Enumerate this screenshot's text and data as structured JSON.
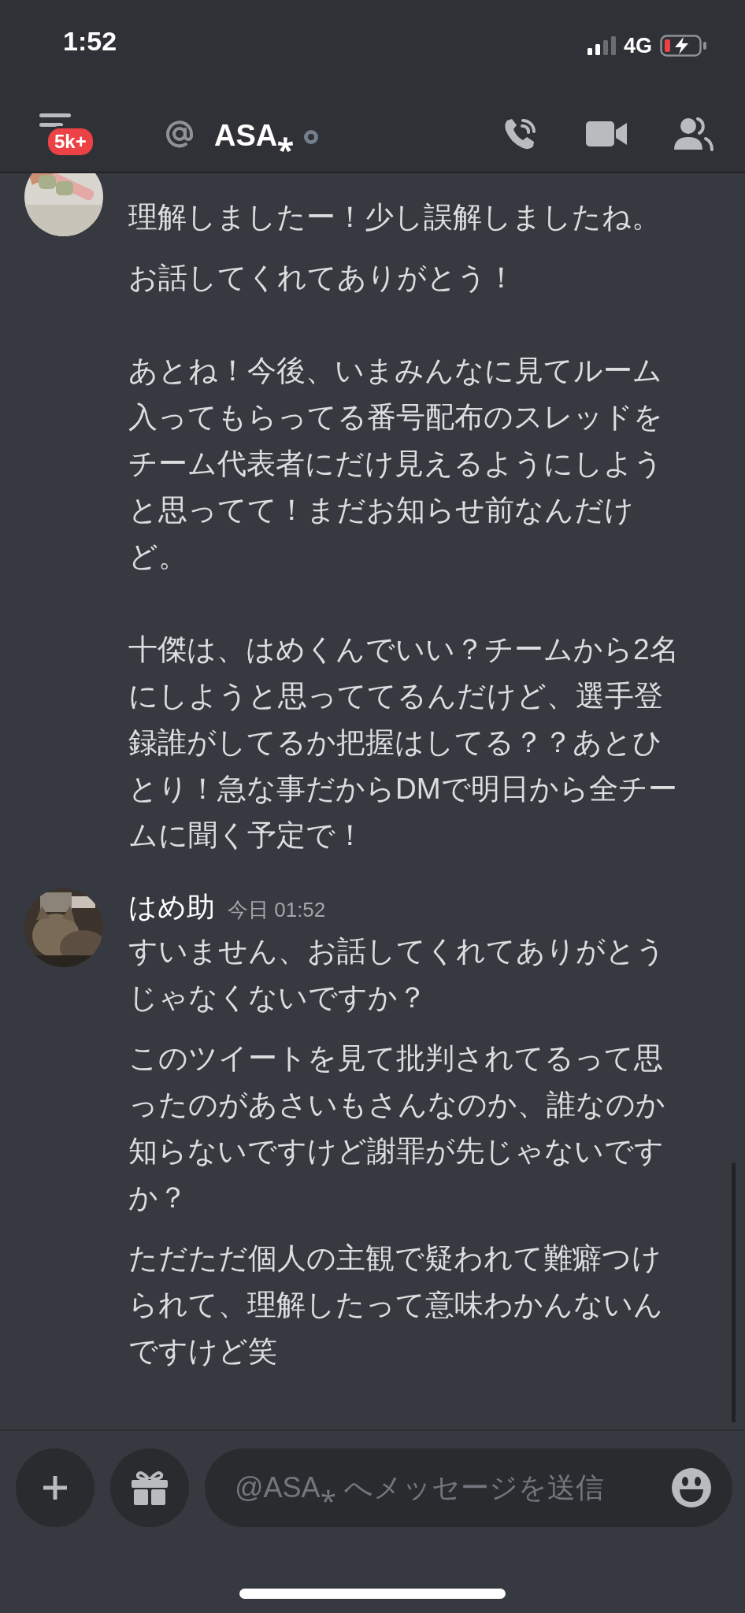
{
  "status_bar": {
    "time": "1:52",
    "network": "4G"
  },
  "header": {
    "badge": "5k+",
    "title": "ASA⁎"
  },
  "messages": [
    {
      "blocks": [
        [
          "理解しましたー！少し誤解しましたね。"
        ],
        [
          "お話してくれてありがとう！",
          "あとね！今後、いまみんなに見てルーム入ってもらってる番号配布のスレッドをチーム代表者にだけ見えるようにしようと思ってて！まだお知らせ前なんだけど。",
          "十傑は、はめくんでいい？チームから2名にしようと思っててるんだけど、選手登録誰がしてるか把握はしてる？？あとひとり！急な事だからDMで明日から全チームに聞く予定で！"
        ]
      ]
    },
    {
      "author": "はめ助",
      "time": "今日 01:52",
      "blocks": [
        [
          "すいません、お話してくれてありがとうじゃなくないですか？"
        ],
        [
          "このツイートを見て批判されてるって思ったのがあさいもさんなのか、誰なのか知らないですけど謝罪が先じゃないですか？"
        ],
        [
          "ただただ個人の主観で疑われて難癖つけられて、理解したって意味わかんないんですけど笑"
        ]
      ]
    }
  ],
  "composer": {
    "placeholder": "@ASA⁎ へメッセージを送信"
  }
}
